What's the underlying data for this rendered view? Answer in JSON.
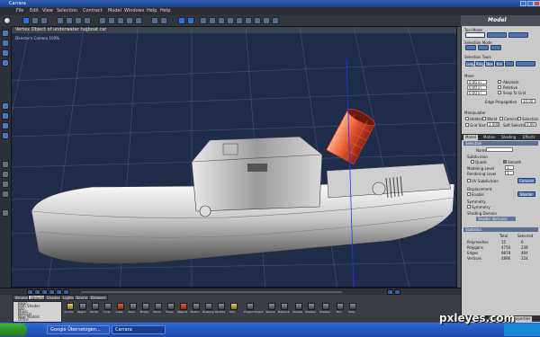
{
  "window": {
    "title": "Carrara"
  },
  "menu": [
    "File",
    "Edit",
    "View",
    "Selection",
    "Contract",
    "Model",
    "Windows",
    "Help",
    "Help"
  ],
  "room": "Model",
  "viewport": {
    "title": "Vertex Object of underwater tugboat.car",
    "camera": "Director's Camera 100%"
  },
  "right_panel": {
    "top_sections": {
      "tool_mode": "Tool Mode",
      "selection_mode": "Selection Mode",
      "selection_tools": "Selection Tools",
      "selection_tool_buttons": [
        "Loop",
        "Ring",
        "Box",
        "Inv"
      ],
      "move": "Move",
      "move_values": [
        "0.00 in",
        "0.00 in",
        "0.00 in"
      ],
      "move_options": [
        "Absolute",
        "Relative",
        "Snap To Grid"
      ],
      "edge_propagation_label": "Edge Propagation",
      "edge_propagation_value": "10.00",
      "manipulator": "Manipulator",
      "manipulator_options": [
        "Hidden",
        "World",
        "Camera",
        "Selection"
      ],
      "grid_size_label": "Grid Size",
      "grid_size_value": "1.000",
      "soft_selection_label": "Soft Selection",
      "soft_selection_value": "0.00"
    },
    "tabs": [
      "Model",
      "Motion",
      "Shading",
      "Effects"
    ],
    "selection_header": "Selection",
    "name_label": "Name",
    "name_value": "",
    "subdivision": "Subdivision",
    "subdivision_opts": [
      "Quads",
      "Smooth"
    ],
    "modeling_level_label": "Modeling Level",
    "modeling_level_value": "1",
    "rendering_level_label": "Rendering Level",
    "rendering_level_value": "1",
    "uv_subdivision": "UV Subdivision",
    "convert_btn": "Convert",
    "displacement": "Displacement",
    "enable": "Enable",
    "shader_btn": "Shader",
    "symmetry": "Symmetry",
    "symmetry_opt": "Symmetry",
    "shading_domain_label": "Shading Domain",
    "shading_domain_value": "Shader domains",
    "statistics_header": "Statistics",
    "stats_cols": [
      "Total",
      "Selected"
    ],
    "stats": [
      {
        "label": "Polymeshes",
        "total": "15",
        "sel": "0"
      },
      {
        "label": "Polygons",
        "total": "4750",
        "sel": "238"
      },
      {
        "label": "Edges",
        "total": "9878",
        "sel": "494"
      },
      {
        "label": "Vertices",
        "total": "4896",
        "sel": "224"
      }
    ],
    "bottom_tabs": [
      "Sequencer",
      "Overview",
      "Properties"
    ]
  },
  "library": {
    "tabs": [
      "Browser",
      "Objects",
      "Shaders",
      "Lights",
      "Scene",
      "Browser"
    ],
    "list": [
      "Basic",
      "Path Shader",
      "Blur",
      "Music",
      "Natural",
      "New Models",
      "Office"
    ],
    "icons": [
      "Anchor",
      "Object",
      "Vertex",
      "Cone",
      "Cube",
      "Deco",
      "Empty",
      "Plane",
      "Faces",
      "Magnet",
      "Motion",
      "Drawing",
      "Particle",
      "Plan",
      "Project Project",
      "Sphere",
      "Network",
      "Sample",
      "Shadow",
      "Shadow",
      "Tool",
      "Tube"
    ]
  },
  "taskbar": {
    "tasks": [
      "Google Übersetzgen...",
      "Carrara"
    ]
  },
  "watermark": "pxleyes.com",
  "colors": {
    "accent": "#4f75b5",
    "viewport_bg": "#202d4a",
    "selection": "#e8593a"
  }
}
